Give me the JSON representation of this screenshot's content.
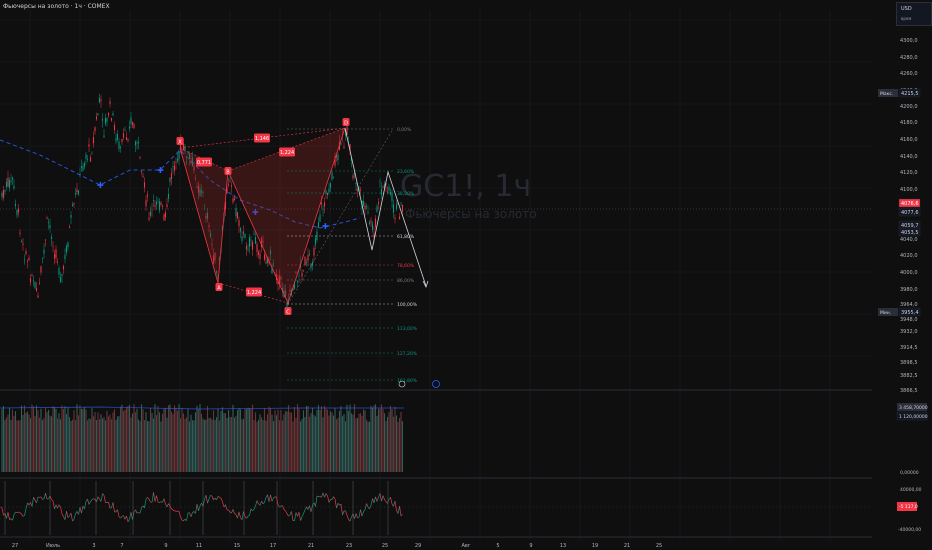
{
  "header": {
    "title": "Фьючерсы на золото · 1ч · COMEX"
  },
  "currency_box": {
    "currency": "USD",
    "sub": "врем"
  },
  "watermark": {
    "symbol": "GC1!, 1ч",
    "name": "Фьючерсы на золото"
  },
  "price_axis": {
    "ticks": [
      "4300,0",
      "4280,0",
      "4260,0",
      "4240,0",
      "4200,0",
      "4180,0",
      "4160,0",
      "4140,0",
      "4120,0",
      "4100,0",
      "4040,0",
      "4020,0",
      "4000,0",
      "3980,0",
      "3964,0",
      "3948,0",
      "3932,0",
      "3914,5",
      "3898,5",
      "3882,5",
      "3866,5"
    ],
    "labels": [
      {
        "text": "Макс.",
        "value": "4215,5",
        "color": "#131722",
        "text_color": "#d1d4dc"
      },
      {
        "text": "",
        "value": "4076,6",
        "color": "#f23645",
        "text_color": "#ffffff"
      },
      {
        "text": "",
        "value": "4077,6",
        "color": "#131722",
        "text_color": "#d1d4dc"
      },
      {
        "text": "",
        "value": "4059,7",
        "color": "#131722",
        "text_color": "#d1d4dc"
      },
      {
        "text": "",
        "value": "4053,5",
        "color": "#131722",
        "text_color": "#d1d4dc"
      },
      {
        "text": "Мин.",
        "value": "3955,4",
        "color": "#131722",
        "text_color": "#d1d4dc"
      }
    ]
  },
  "volume_axis": {
    "v1": "3 458,70000",
    "v2": "1 120,00000",
    "zero": "0,00000"
  },
  "osc_axis": {
    "top": "40000,00",
    "value": "-5 117,0",
    "bottom": "-40000,00"
  },
  "time_axis": [
    "27",
    "Июль",
    "3",
    "7",
    "9",
    "11",
    "15",
    "17",
    "21",
    "23",
    "25",
    "29",
    "Авг",
    "5",
    "9",
    "13",
    "19",
    "21",
    "25"
  ],
  "pattern": {
    "points": [
      "X",
      "A",
      "B",
      "C",
      "D"
    ],
    "ratios": [
      "0,771",
      "1,146",
      "1,224",
      "1,224"
    ]
  },
  "fib": {
    "levels": [
      "0,00%",
      "23,60%",
      "38,20%",
      "61,80%",
      "78,60%",
      "86,00%",
      "100,00%",
      "113,00%",
      "127,20%",
      "161,80%"
    ],
    "colors": [
      "#787b86",
      "#089981",
      "#089981",
      "#d1d4dc",
      "#f23645",
      "#787b86",
      "#d1d4dc",
      "#089981",
      "#089981",
      "#089981"
    ]
  },
  "colors": {
    "up": "#089981",
    "down": "#f23645",
    "accent": "#2962ff",
    "pattern_fill": "#8a2525"
  }
}
